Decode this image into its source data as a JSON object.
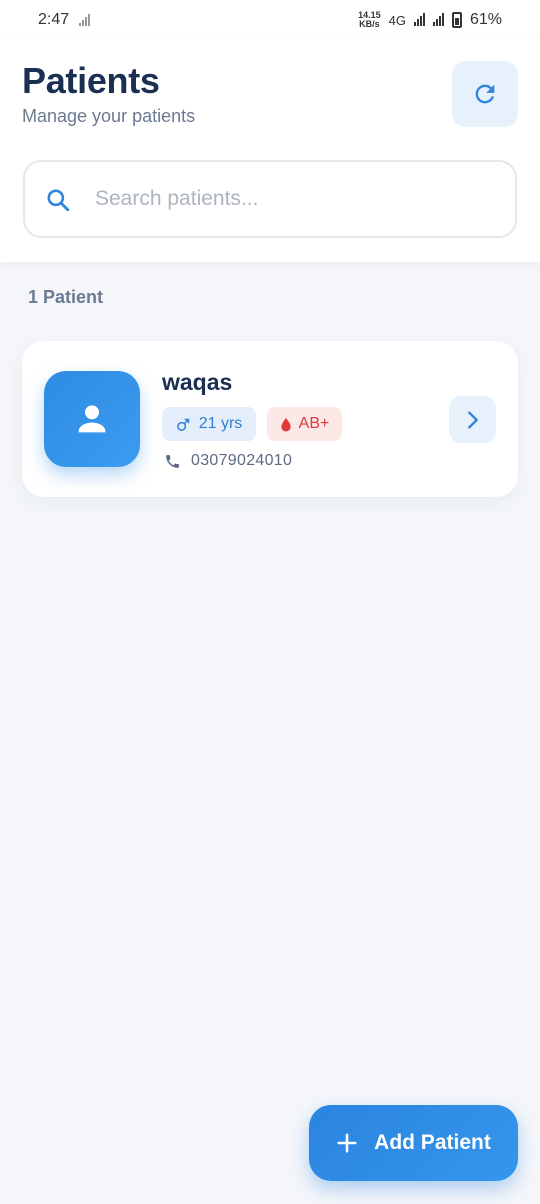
{
  "status_bar": {
    "time": "2:47",
    "net_speed_value": "14.15",
    "net_speed_unit": "KB/s",
    "network_type": "4G",
    "battery": "61%"
  },
  "header": {
    "title": "Patients",
    "subtitle": "Manage your patients",
    "refresh_icon": "refresh-icon"
  },
  "search": {
    "placeholder": "Search patients...",
    "value": "",
    "icon": "search-icon"
  },
  "patient_count": "1 Patient",
  "patients": [
    {
      "name": "waqas",
      "gender_icon": "male-icon",
      "age": "21 yrs",
      "blood_icon": "blood-drop-icon",
      "blood_group": "AB+",
      "phone": "03079024010"
    }
  ],
  "fab": {
    "label": "Add Patient",
    "icon": "plus-icon"
  },
  "colors": {
    "primary": "#2f8be3",
    "title": "#1b2f52",
    "muted": "#6b7a90",
    "blood": "#e03a3a",
    "background": "#f4f6fa"
  }
}
